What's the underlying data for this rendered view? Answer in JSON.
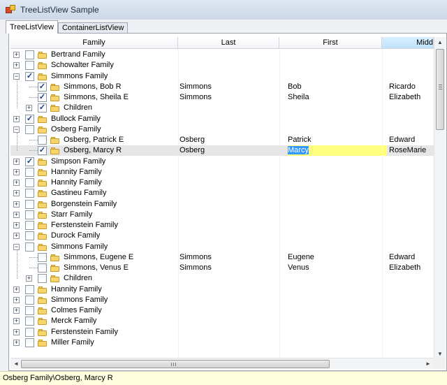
{
  "window": {
    "title": "TreeListView Sample"
  },
  "tabs": [
    {
      "label": "TreeListView",
      "active": true
    },
    {
      "label": "ContainerListView",
      "active": false
    }
  ],
  "columns": [
    "Family",
    "Last",
    "First",
    "Midd"
  ],
  "rows": [
    {
      "depth": 0,
      "expander": "+",
      "checked": false,
      "label": "Bertrand Family",
      "last": "",
      "first": "",
      "middle": ""
    },
    {
      "depth": 0,
      "expander": "+",
      "checked": false,
      "label": "Schowalter Family",
      "last": "",
      "first": "",
      "middle": ""
    },
    {
      "depth": 0,
      "expander": "−",
      "checked": true,
      "label": "Simmons Family",
      "last": "",
      "first": "",
      "middle": ""
    },
    {
      "depth": 1,
      "expander": "",
      "checked": true,
      "label": "Simmons, Bob R",
      "last": "Simmons",
      "first": "Bob",
      "middle": "Ricardo"
    },
    {
      "depth": 1,
      "expander": "",
      "checked": true,
      "label": "Simmons, Sheila E",
      "last": "Simmons",
      "first": "Sheila",
      "middle": "Elizabeth"
    },
    {
      "depth": 1,
      "expander": "+",
      "checked": true,
      "label": "Children",
      "last": "",
      "first": "",
      "middle": ""
    },
    {
      "depth": 0,
      "expander": "+",
      "checked": true,
      "label": "Bullock Family",
      "last": "",
      "first": "",
      "middle": ""
    },
    {
      "depth": 0,
      "expander": "−",
      "checked": false,
      "label": "Osberg Family",
      "last": "",
      "first": "",
      "middle": ""
    },
    {
      "depth": 1,
      "expander": "",
      "checked": false,
      "label": "Osberg, Patrick E",
      "last": "Osberg",
      "first": "Patrick",
      "middle": "Edward"
    },
    {
      "depth": 1,
      "expander": "",
      "checked": true,
      "label": "Osberg, Marcy R",
      "last": "Osberg",
      "first": "Marcy",
      "middle": "RoseMarie",
      "selected": true,
      "editing": true
    },
    {
      "depth": 0,
      "expander": "+",
      "checked": true,
      "label": "Simpson Family",
      "last": "",
      "first": "",
      "middle": ""
    },
    {
      "depth": 0,
      "expander": "+",
      "checked": false,
      "label": "Hannity Family",
      "last": "",
      "first": "",
      "middle": ""
    },
    {
      "depth": 0,
      "expander": "+",
      "checked": false,
      "label": "Hannity Family",
      "last": "",
      "first": "",
      "middle": ""
    },
    {
      "depth": 0,
      "expander": "+",
      "checked": false,
      "label": "Gastineu Family",
      "last": "",
      "first": "",
      "middle": ""
    },
    {
      "depth": 0,
      "expander": "+",
      "checked": false,
      "label": "Borgenstein Family",
      "last": "",
      "first": "",
      "middle": ""
    },
    {
      "depth": 0,
      "expander": "+",
      "checked": false,
      "label": "Starr Family",
      "last": "",
      "first": "",
      "middle": ""
    },
    {
      "depth": 0,
      "expander": "+",
      "checked": false,
      "label": "Ferstenstein Family",
      "last": "",
      "first": "",
      "middle": ""
    },
    {
      "depth": 0,
      "expander": "+",
      "checked": false,
      "label": "Durock Family",
      "last": "",
      "first": "",
      "middle": ""
    },
    {
      "depth": 0,
      "expander": "−",
      "checked": false,
      "label": "Simmons Family",
      "last": "",
      "first": "",
      "middle": ""
    },
    {
      "depth": 1,
      "expander": "",
      "checked": false,
      "label": "Simmons, Eugene E",
      "last": "Simmons",
      "first": "Eugene",
      "middle": "Edward"
    },
    {
      "depth": 1,
      "expander": "",
      "checked": false,
      "label": "Simmons, Venus E",
      "last": "Simmons",
      "first": "Venus",
      "middle": "Elizabeth"
    },
    {
      "depth": 1,
      "expander": "+",
      "checked": false,
      "label": "Children",
      "last": "",
      "first": "",
      "middle": ""
    },
    {
      "depth": 0,
      "expander": "+",
      "checked": false,
      "label": "Hannity Family",
      "last": "",
      "first": "",
      "middle": ""
    },
    {
      "depth": 0,
      "expander": "+",
      "checked": false,
      "label": "Simmons Family",
      "last": "",
      "first": "",
      "middle": ""
    },
    {
      "depth": 0,
      "expander": "+",
      "checked": false,
      "label": "Colmes Family",
      "last": "",
      "first": "",
      "middle": ""
    },
    {
      "depth": 0,
      "expander": "+",
      "checked": false,
      "label": "Merck Family",
      "last": "",
      "first": "",
      "middle": ""
    },
    {
      "depth": 0,
      "expander": "+",
      "checked": false,
      "label": "Ferstenstein Family",
      "last": "",
      "first": "",
      "middle": ""
    },
    {
      "depth": 0,
      "expander": "+",
      "checked": false,
      "label": "Miller Family",
      "last": "",
      "first": "",
      "middle": ""
    }
  ],
  "scrollbars": {
    "left_arrow": "◄",
    "right_arrow": "►",
    "up_arrow": "▲",
    "down_arrow": "▼",
    "grip": "III",
    "vgrip": "≡"
  },
  "status": {
    "text": "Osberg Family\\Osberg, Marcy R"
  },
  "colors": {
    "selected_row": "#e6e6e6",
    "edit_background": "#ffff80",
    "text_selection": "#3399ff",
    "status_background": "#ffffdf",
    "sorted_header": "#bfe2fb"
  }
}
